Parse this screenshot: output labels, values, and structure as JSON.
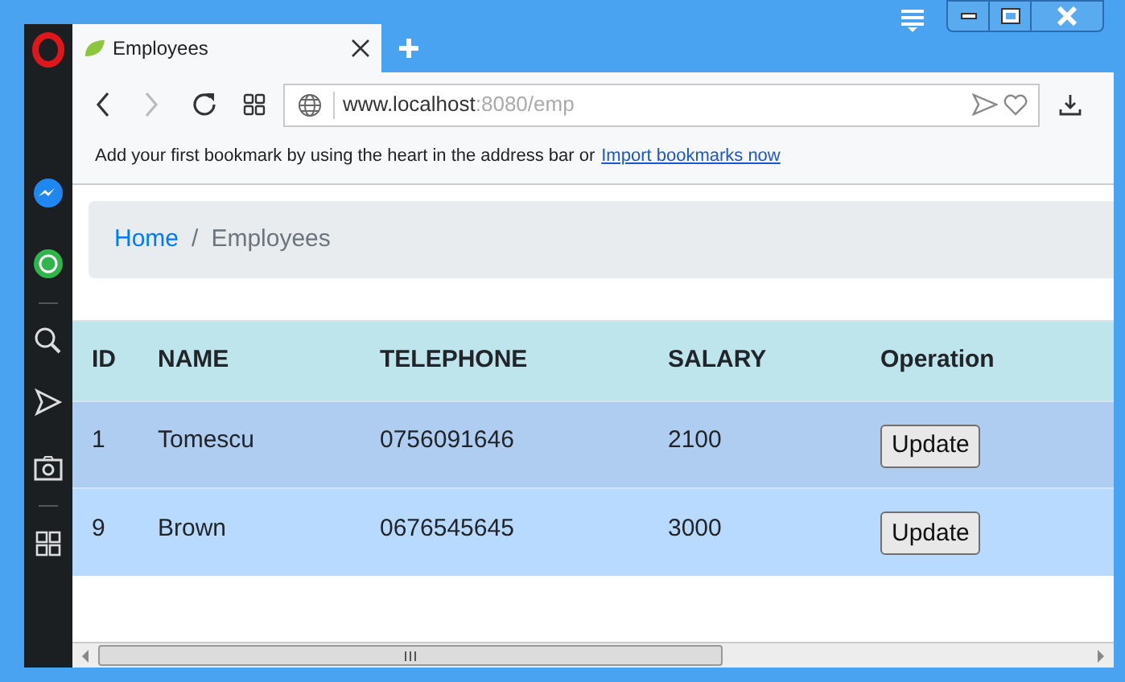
{
  "tab": {
    "title": "Employees"
  },
  "address_bar": {
    "host": "www.localhost",
    "rest": ":8080/emp"
  },
  "bookmarks_bar": {
    "message": "Add your first bookmark by using the heart in the address bar or",
    "link": "Import bookmarks now"
  },
  "breadcrumb": [
    {
      "label": "Home",
      "kind": "link"
    },
    {
      "label": "/",
      "kind": "separator"
    },
    {
      "label": "Employees",
      "kind": "current"
    }
  ],
  "table": {
    "columns": [
      "ID",
      "NAME",
      "TELEPHONE",
      "SALARY",
      "Operation"
    ],
    "rows": [
      {
        "cells": [
          "1",
          "Tomescu",
          "0756091646",
          "2100"
        ],
        "action": "Update"
      },
      {
        "cells": [
          "9",
          "Brown",
          "0676545645",
          "3000"
        ],
        "action": "Update"
      }
    ]
  }
}
